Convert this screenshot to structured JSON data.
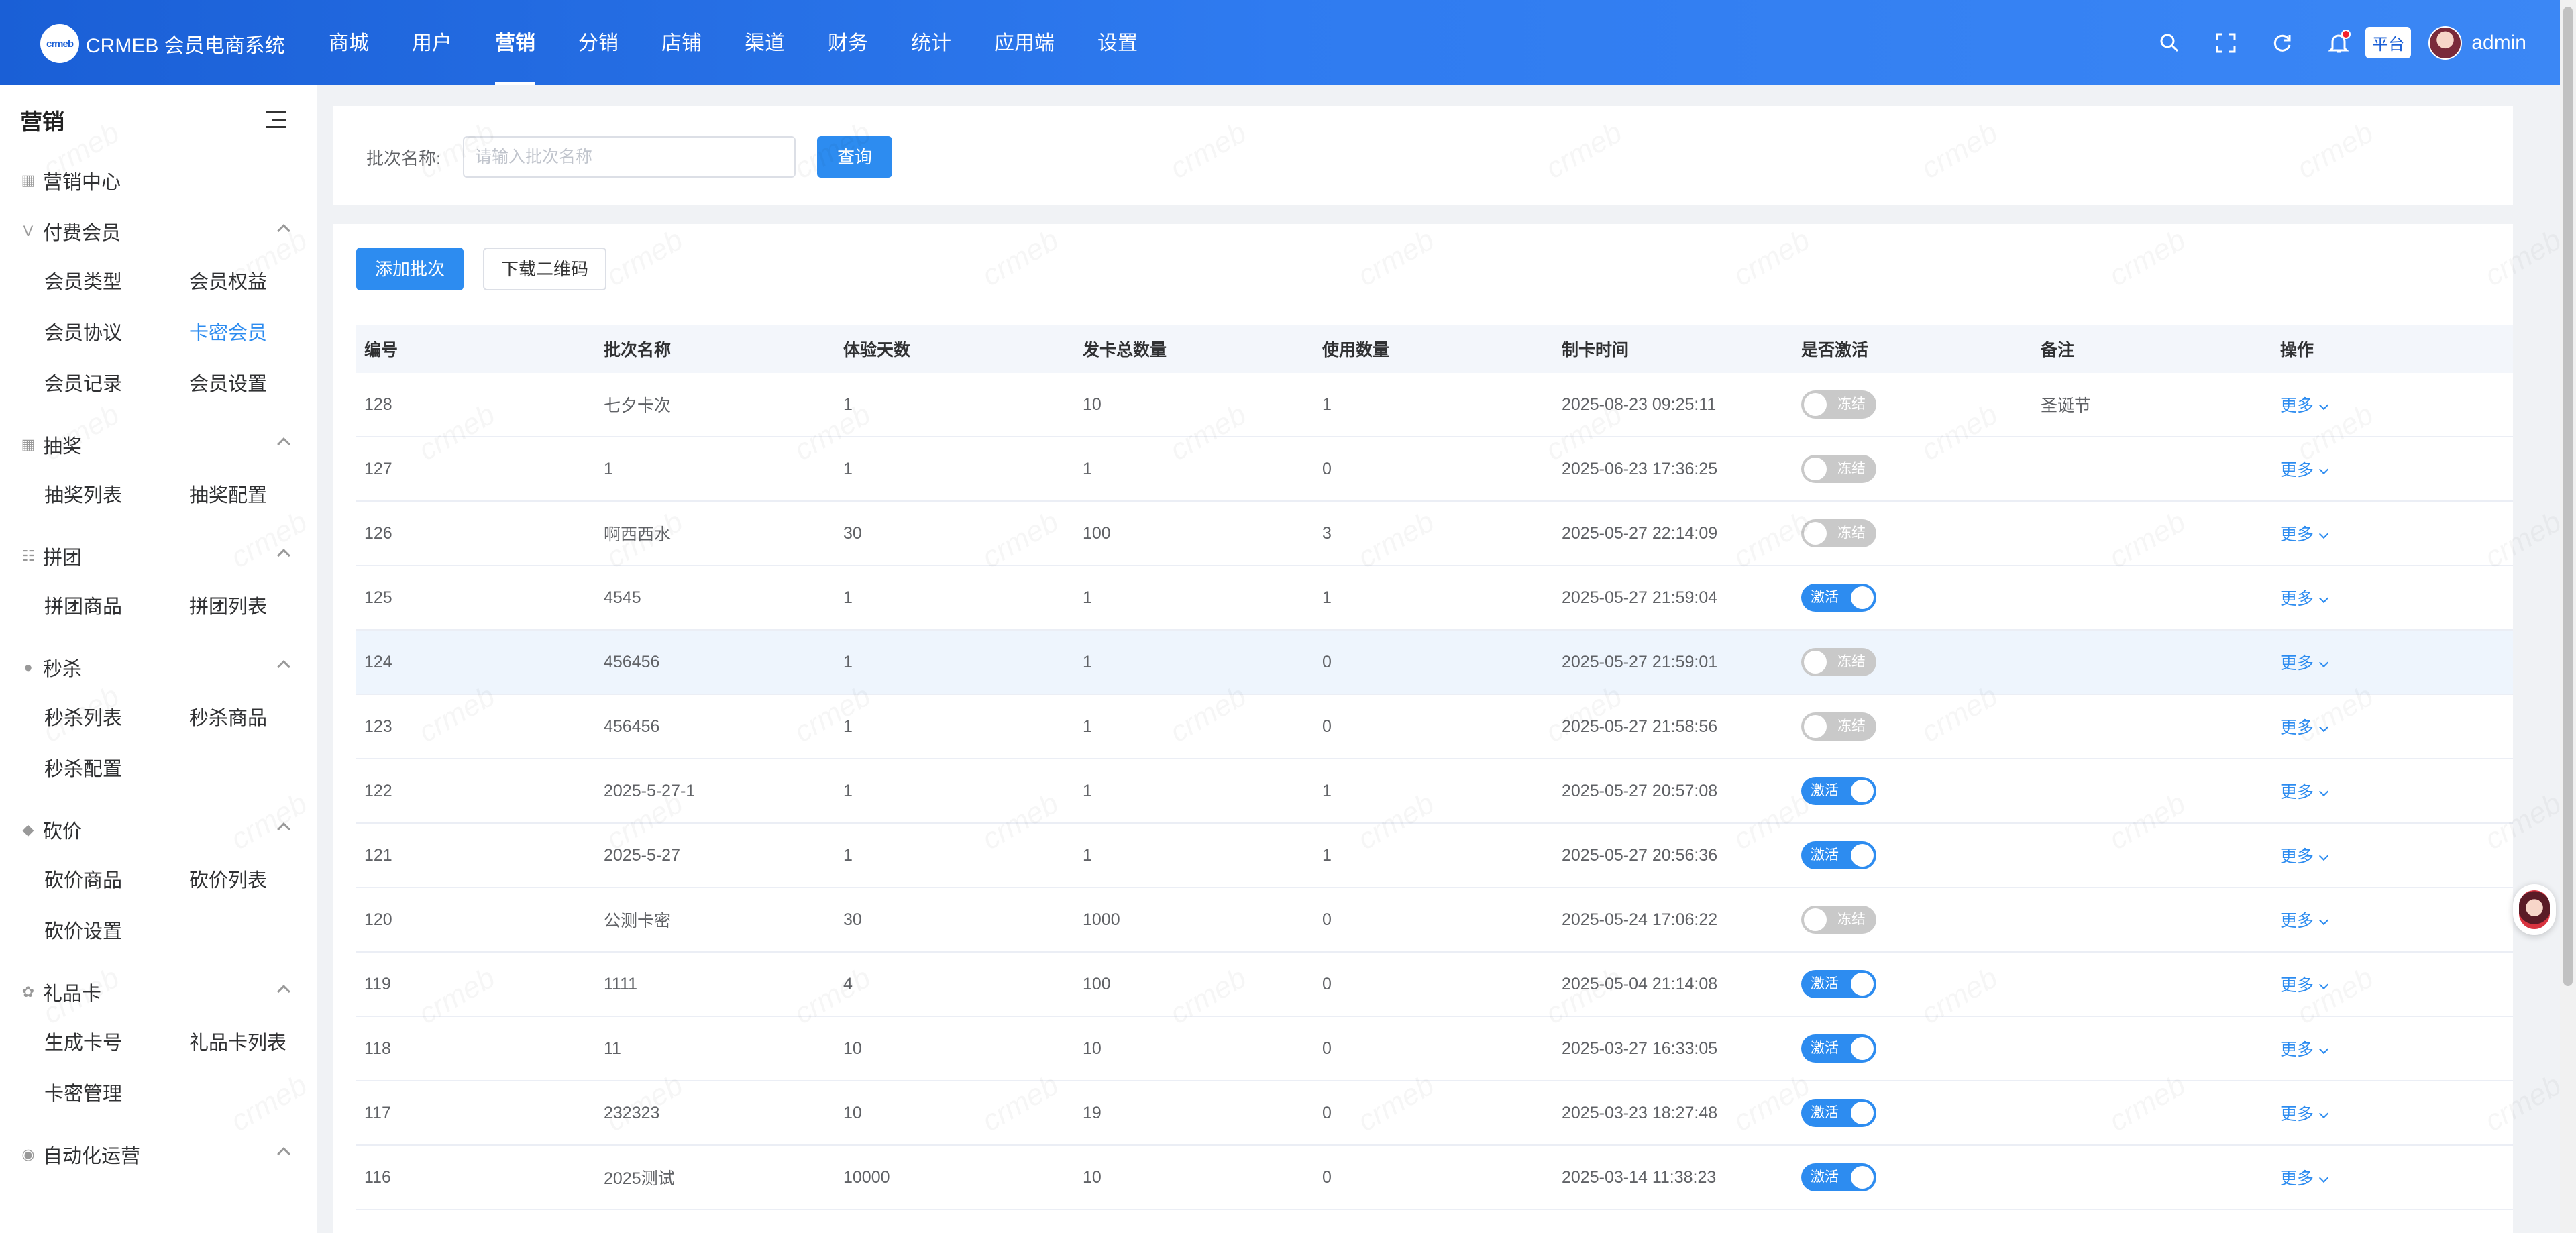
{
  "brand": {
    "logo_text": "crmeb",
    "name": "CRMEB 会员电商系统"
  },
  "topnav": [
    {
      "label": "商城",
      "active": false
    },
    {
      "label": "用户",
      "active": false
    },
    {
      "label": "营销",
      "active": true
    },
    {
      "label": "分销",
      "active": false
    },
    {
      "label": "店铺",
      "active": false
    },
    {
      "label": "渠道",
      "active": false
    },
    {
      "label": "财务",
      "active": false
    },
    {
      "label": "统计",
      "active": false
    },
    {
      "label": "应用端",
      "active": false
    },
    {
      "label": "设置",
      "active": false
    }
  ],
  "header_right": {
    "platform_tag": "平台",
    "username": "admin"
  },
  "sidebar": {
    "title": "营销",
    "groups": [
      {
        "label": "营销中心",
        "icon": "grid-icon",
        "items": []
      },
      {
        "label": "付费会员",
        "icon": "vip-icon",
        "items": [
          "会员类型",
          "会员权益",
          "会员协议",
          "卡密会员",
          "会员记录",
          "会员设置"
        ],
        "active_item": "卡密会员"
      },
      {
        "label": "抽奖",
        "icon": "lottery-icon",
        "items": [
          "抽奖列表",
          "抽奖配置"
        ]
      },
      {
        "label": "拼团",
        "icon": "group-icon",
        "items": [
          "拼团商品",
          "拼团列表"
        ]
      },
      {
        "label": "秒杀",
        "icon": "seckill-icon",
        "items": [
          "秒杀列表",
          "秒杀商品",
          "秒杀配置"
        ]
      },
      {
        "label": "砍价",
        "icon": "bargain-icon",
        "items": [
          "砍价商品",
          "砍价列表",
          "砍价设置"
        ]
      },
      {
        "label": "礼品卡",
        "icon": "gift-icon",
        "items": [
          "生成卡号",
          "礼品卡列表",
          "卡密管理"
        ]
      },
      {
        "label": "自动化运营",
        "icon": "auto-icon",
        "items": []
      }
    ]
  },
  "search": {
    "label": "批次名称:",
    "placeholder": "请输入批次名称",
    "button": "查询"
  },
  "toolbar": {
    "add_label": "添加批次",
    "qr_label": "下载二维码"
  },
  "table": {
    "columns": [
      "编号",
      "批次名称",
      "体验天数",
      "发卡总数量",
      "使用数量",
      "制卡时间",
      "是否激活",
      "备注",
      "操作"
    ],
    "switch_on_label": "激活",
    "switch_off_label": "冻结",
    "more_label": "更多",
    "rows": [
      {
        "id": "128",
        "name": "七夕卡次",
        "days": "1",
        "total": "10",
        "used": "1",
        "time": "2025-08-23 09:25:11",
        "active": false,
        "remark": "圣诞节"
      },
      {
        "id": "127",
        "name": "1",
        "days": "1",
        "total": "1",
        "used": "0",
        "time": "2025-06-23 17:36:25",
        "active": false,
        "remark": ""
      },
      {
        "id": "126",
        "name": "啊西西水",
        "days": "30",
        "total": "100",
        "used": "3",
        "time": "2025-05-27 22:14:09",
        "active": false,
        "remark": ""
      },
      {
        "id": "125",
        "name": "4545",
        "days": "1",
        "total": "1",
        "used": "1",
        "time": "2025-05-27 21:59:04",
        "active": true,
        "remark": ""
      },
      {
        "id": "124",
        "name": "456456",
        "days": "1",
        "total": "1",
        "used": "0",
        "time": "2025-05-27 21:59:01",
        "active": false,
        "remark": "",
        "hover": true
      },
      {
        "id": "123",
        "name": "456456",
        "days": "1",
        "total": "1",
        "used": "0",
        "time": "2025-05-27 21:58:56",
        "active": false,
        "remark": ""
      },
      {
        "id": "122",
        "name": "2025-5-27-1",
        "days": "1",
        "total": "1",
        "used": "1",
        "time": "2025-05-27 20:57:08",
        "active": true,
        "remark": ""
      },
      {
        "id": "121",
        "name": "2025-5-27",
        "days": "1",
        "total": "1",
        "used": "1",
        "time": "2025-05-27 20:56:36",
        "active": true,
        "remark": ""
      },
      {
        "id": "120",
        "name": "公测卡密",
        "days": "30",
        "total": "1000",
        "used": "0",
        "time": "2025-05-24 17:06:22",
        "active": false,
        "remark": ""
      },
      {
        "id": "119",
        "name": "1111",
        "days": "4",
        "total": "100",
        "used": "0",
        "time": "2025-05-04 21:14:08",
        "active": true,
        "remark": ""
      },
      {
        "id": "118",
        "name": "11",
        "days": "10",
        "total": "10",
        "used": "0",
        "time": "2025-03-27 16:33:05",
        "active": true,
        "remark": ""
      },
      {
        "id": "117",
        "name": "232323",
        "days": "10",
        "total": "19",
        "used": "0",
        "time": "2025-03-23 18:27:48",
        "active": true,
        "remark": ""
      },
      {
        "id": "116",
        "name": "2025测试",
        "days": "10000",
        "total": "10",
        "used": "0",
        "time": "2025-03-14 11:38:23",
        "active": true,
        "remark": ""
      }
    ]
  },
  "colors": {
    "primary": "#2d8cf0",
    "header_start": "#1a5fd6",
    "header_end": "#3b87f5",
    "switch_off": "#c9c9c9"
  }
}
